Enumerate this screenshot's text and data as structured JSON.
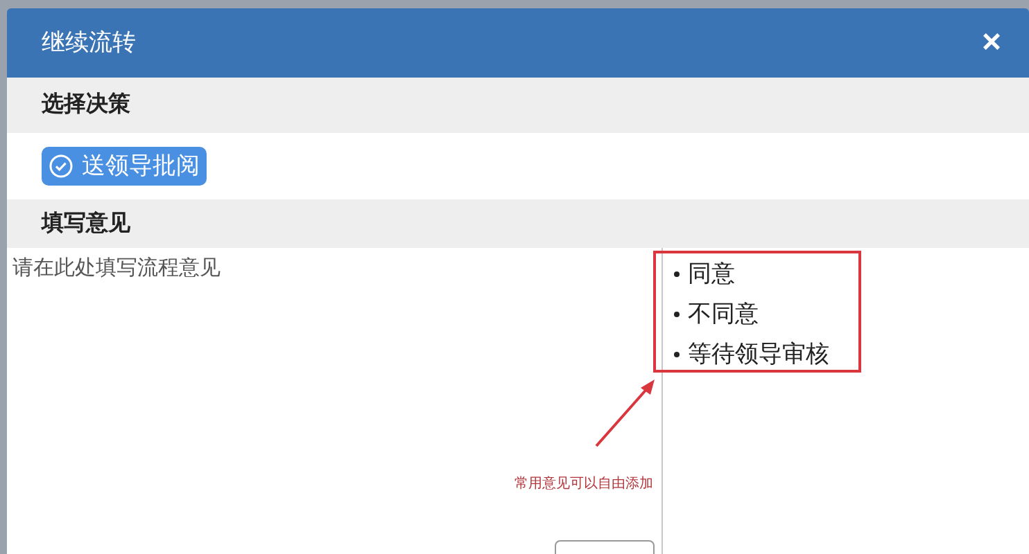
{
  "dialog": {
    "title": "继续流转",
    "close": "×"
  },
  "decision_section": {
    "heading": "选择决策",
    "options": [
      {
        "label": "送领导批阅",
        "selected": true
      }
    ]
  },
  "opinion_section": {
    "heading": "填写意见",
    "textarea": {
      "placeholder": "请在此处填写流程意见"
    },
    "common_opinions": [
      {
        "label": "同意"
      },
      {
        "label": "不同意"
      },
      {
        "label": "等待领导审核"
      }
    ]
  },
  "annotation": {
    "note": "常用意见可以自由添加"
  }
}
